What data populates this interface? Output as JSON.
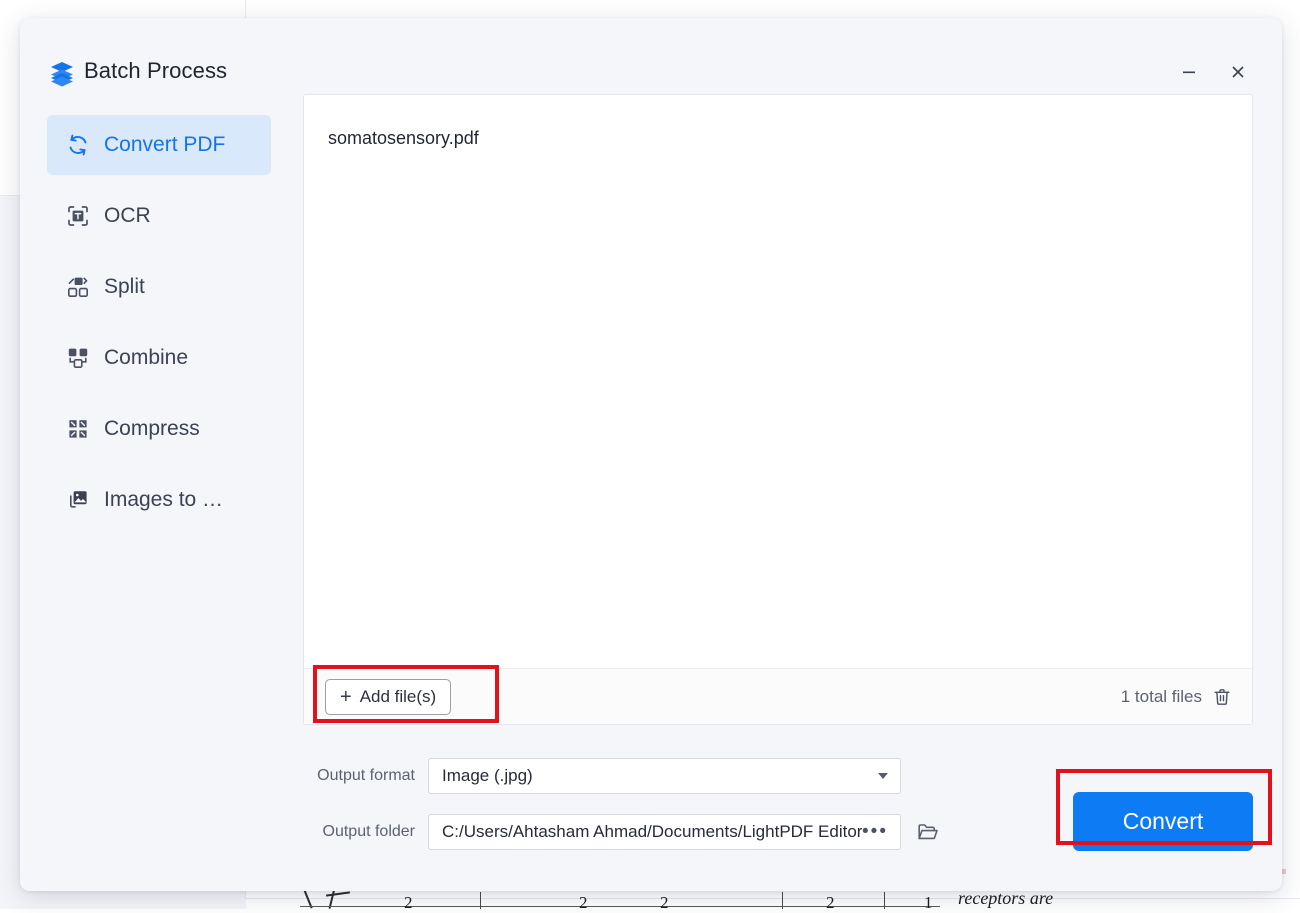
{
  "window": {
    "title": "Batch Process",
    "logo_icon": "layers-stack-icon",
    "minimize_icon": "minimize-icon",
    "close_icon": "close-icon",
    "accent_color": "#0c7bf4",
    "active_item_bg": "#d9e8fb",
    "annotation_color": "#e3111b"
  },
  "sidebar": {
    "items": [
      {
        "label": "Convert PDF",
        "icon": "convert-refresh-icon",
        "active": true
      },
      {
        "label": "OCR",
        "icon": "ocr-text-scan-icon",
        "active": false
      },
      {
        "label": "Split",
        "icon": "split-icon",
        "active": false
      },
      {
        "label": "Combine",
        "icon": "combine-icon",
        "active": false
      },
      {
        "label": "Compress",
        "icon": "compress-icon",
        "active": false
      },
      {
        "label": "Images to …",
        "icon": "images-to-pdf-icon",
        "active": false
      }
    ]
  },
  "file_panel": {
    "files": [
      {
        "name": "somatosensory.pdf"
      }
    ],
    "add_files_label": "Add file(s)",
    "add_files_plus": "+",
    "total_files_label": "1 total files",
    "delete_icon": "trash-icon"
  },
  "form": {
    "output_format": {
      "label": "Output format",
      "value": "Image (.jpg)",
      "caret_icon": "chevron-down-icon"
    },
    "output_folder": {
      "label": "Output folder",
      "value": "C:/Users/Ahtasham Ahmad/Documents/LightPDF Editor",
      "more_icon": "ellipsis-icon",
      "browse_icon": "folder-open-icon"
    }
  },
  "actions": {
    "convert_label": "Convert"
  },
  "background": {
    "document_text": "receptors  are",
    "digits": [
      "2",
      "2",
      "2",
      "2",
      "1"
    ]
  }
}
